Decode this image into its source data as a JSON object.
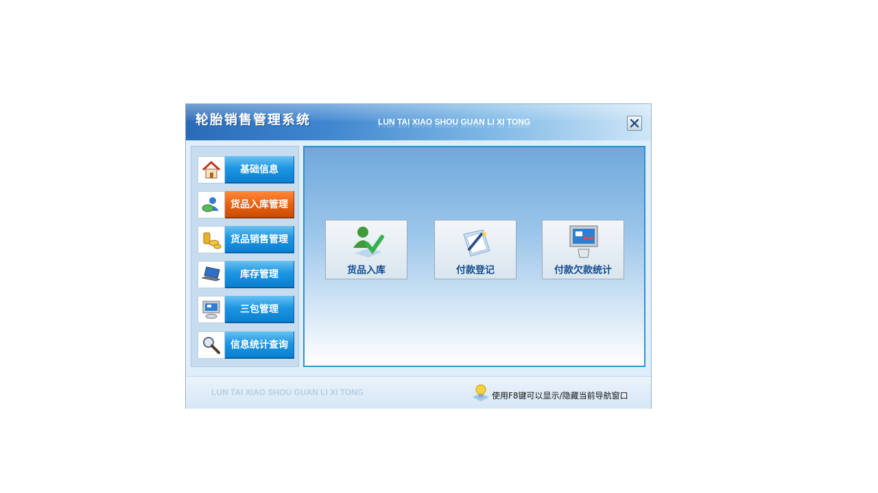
{
  "window": {
    "title_cn": "轮胎销售管理系统",
    "title_en": "LUN TAI XIAO SHOU GUAN LI XI TONG",
    "close_label": "×"
  },
  "sidebar": {
    "items": [
      {
        "label": "基础信息",
        "icon": "home-icon",
        "active": false
      },
      {
        "label": "货品入库管理",
        "icon": "person-globe-icon",
        "active": true
      },
      {
        "label": "货品销售管理",
        "icon": "coins-icon",
        "active": false
      },
      {
        "label": "库存管理",
        "icon": "laptop-icon",
        "active": false
      },
      {
        "label": "三包管理",
        "icon": "monitor-icon",
        "active": false
      },
      {
        "label": "信息统计查询",
        "icon": "magnifier-icon",
        "active": false
      }
    ]
  },
  "main": {
    "tiles": [
      {
        "label": "货品入库",
        "icon": "user-check-icon"
      },
      {
        "label": "付款登记",
        "icon": "document-pen-icon"
      },
      {
        "label": "付款欠款统计",
        "icon": "monitor-stats-icon"
      }
    ]
  },
  "footer": {
    "watermark": "LUN TAI XIAO SHOU GUAN LI XI TONG",
    "hint": "使用F8键可以显示/隐藏当前导航窗口",
    "hint_icon": "lightbulb-icon"
  },
  "colors": {
    "active_nav": "#ea6212",
    "nav_blue": "#1e96e2",
    "main_border": "#2f8fd0",
    "tile_text": "#124c8e"
  }
}
